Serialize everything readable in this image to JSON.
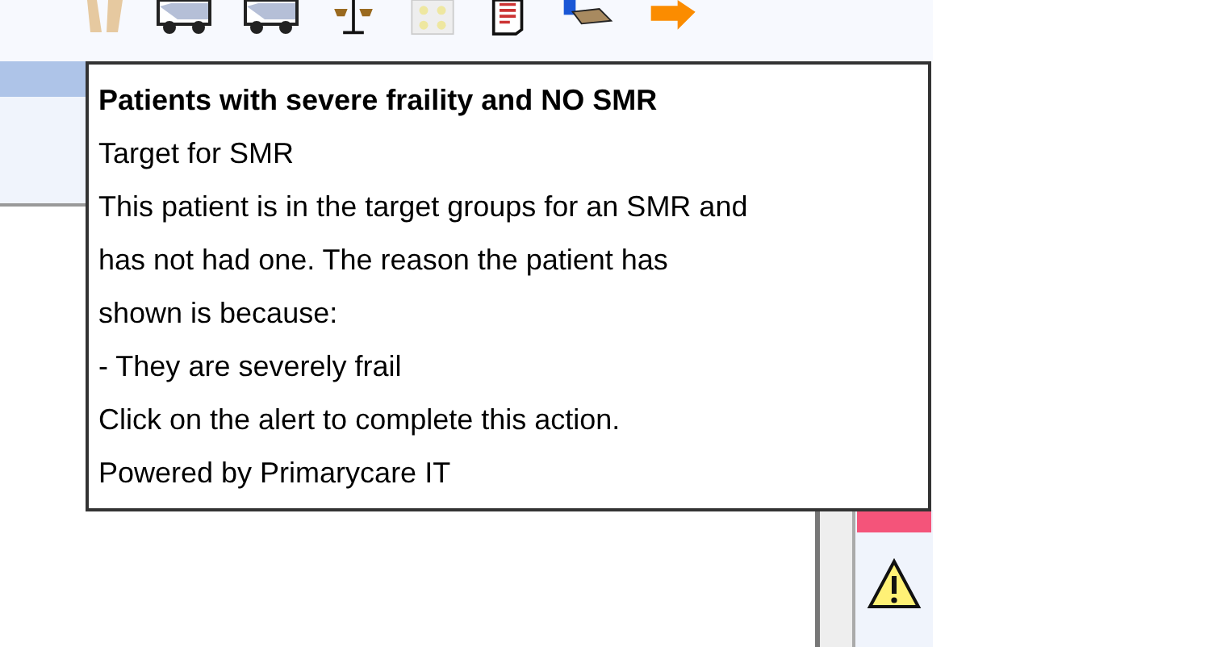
{
  "tooltip": {
    "title": "Patients with severe fraility and NO SMR",
    "lines": [
      "Target for SMR",
      "This patient is in the target groups for an SMR and",
      "has not had one. The reason the patient has",
      "shown is because:",
      "- They are severely frail",
      "Click on the alert to complete this action.",
      "Powered by Primarycare IT"
    ]
  }
}
